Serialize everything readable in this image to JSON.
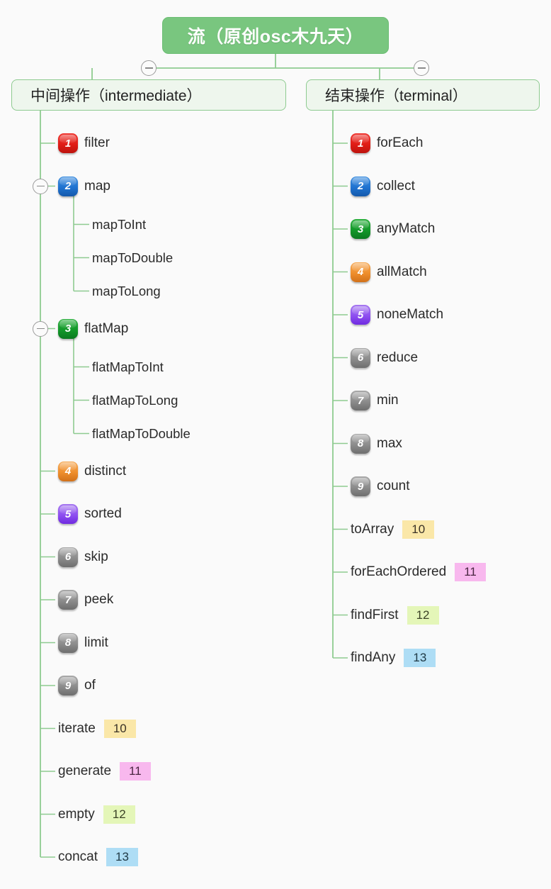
{
  "background_color": "#fafafa",
  "root": {
    "title": "流（原创osc木九天）",
    "background_color": "#79c67f",
    "text_color": "#ffffff"
  },
  "branches": [
    {
      "id": "intermediate",
      "header": "中间操作（intermediate）",
      "toggle_icon": "minus-circle-icon",
      "nodes": [
        {
          "badge": "1",
          "badge_color": "red",
          "label": "filter"
        },
        {
          "badge": "2",
          "badge_color": "blue",
          "label": "map",
          "toggle_icon": "minus-circle-icon",
          "children": [
            {
              "label": "mapToInt"
            },
            {
              "label": "mapToDouble"
            },
            {
              "label": "mapToLong"
            }
          ]
        },
        {
          "badge": "3",
          "badge_color": "green",
          "label": "flatMap",
          "toggle_icon": "minus-circle-icon",
          "children": [
            {
              "label": "flatMapToInt"
            },
            {
              "label": "flatMapToLong"
            },
            {
              "label": "flatMapToDouble"
            }
          ]
        },
        {
          "badge": "4",
          "badge_color": "orange",
          "label": "distinct"
        },
        {
          "badge": "5",
          "badge_color": "purple",
          "label": "sorted"
        },
        {
          "badge": "6",
          "badge_color": "gray",
          "label": "skip"
        },
        {
          "badge": "7",
          "badge_color": "gray",
          "label": "peek"
        },
        {
          "badge": "8",
          "badge_color": "gray",
          "label": "limit"
        },
        {
          "badge": "9",
          "badge_color": "gray",
          "label": "of"
        },
        {
          "label": "iterate",
          "chip": "10",
          "chip_color": "yellow"
        },
        {
          "label": "generate",
          "chip": "11",
          "chip_color": "pink"
        },
        {
          "label": "empty",
          "chip": "12",
          "chip_color": "lime"
        },
        {
          "label": "concat",
          "chip": "13",
          "chip_color": "skyblue"
        }
      ]
    },
    {
      "id": "terminal",
      "header": "结束操作（terminal）",
      "toggle_icon": "minus-circle-icon",
      "nodes": [
        {
          "badge": "1",
          "badge_color": "red",
          "label": "forEach"
        },
        {
          "badge": "2",
          "badge_color": "blue",
          "label": "collect"
        },
        {
          "badge": "3",
          "badge_color": "green",
          "label": "anyMatch"
        },
        {
          "badge": "4",
          "badge_color": "orange",
          "label": "allMatch"
        },
        {
          "badge": "5",
          "badge_color": "purple",
          "label": "noneMatch"
        },
        {
          "badge": "6",
          "badge_color": "gray",
          "label": "reduce"
        },
        {
          "badge": "7",
          "badge_color": "gray",
          "label": "min"
        },
        {
          "badge": "8",
          "badge_color": "gray",
          "label": "max"
        },
        {
          "badge": "9",
          "badge_color": "gray",
          "label": "count"
        },
        {
          "label": "toArray",
          "chip": "10",
          "chip_color": "yellow"
        },
        {
          "label": "forEachOrdered",
          "chip": "11",
          "chip_color": "pink"
        },
        {
          "label": "findFirst",
          "chip": "12",
          "chip_color": "lime"
        },
        {
          "label": "findAny",
          "chip": "13",
          "chip_color": "skyblue"
        }
      ]
    }
  ],
  "palette": {
    "line": "#8ecb90",
    "badge_red": "#e11d16",
    "badge_blue": "#1f72d0",
    "badge_green": "#13982a",
    "badge_orange": "#ef8e2c",
    "badge_purple": "#8e4ff0",
    "badge_gray": "#8c8c8c",
    "chip_yellow": "#fae7a8",
    "chip_pink": "#f8b8ee",
    "chip_lime": "#e4f6b8",
    "chip_skyblue": "#aeddf5"
  }
}
